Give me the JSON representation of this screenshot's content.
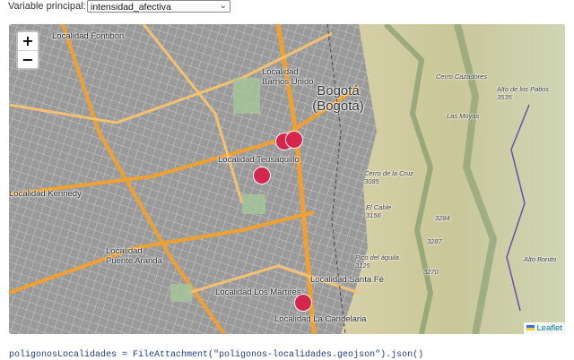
{
  "control": {
    "label": "Variable principal:",
    "selected_option": "intensidad_afectiva"
  },
  "map": {
    "zoom_in": "+",
    "zoom_out": "−",
    "attribution": "Leaflet",
    "labels": {
      "fontibon": "Localidad Fontibón",
      "barrios_unidos": "Localidad Barrios Unido",
      "bogota": "Bogotá (Bogotá)",
      "teusaquillo": "Localidad Teusaquillo",
      "kennedy": "Localidad Kennedy",
      "puente_aranda": "Localidad Puente Aranda",
      "martires": "Localidad Los Mártires",
      "santa_fe": "Localidad Santa Fé",
      "candelaria": "Localidad La Candelaria",
      "cerro_cazadores": "Cerro Cazadores",
      "alto_patios": "Alto de los Patios 3535",
      "las_moyas": "Las Moyas",
      "cerro_cruz": "Cerro de la Cruz 3085",
      "el_cable": "El Cable 3156",
      "alto_bonito": "Alto Bonito",
      "pico_aguila": "Pico del águila 3125",
      "elev_3284": "3284",
      "elev_3287": "3287",
      "elev_3270": "3270"
    },
    "markers_count_visible": 4,
    "colors": {
      "marker": "#d6214b",
      "attribution_link": "#0078A8"
    }
  },
  "code_line": "poligonosLocalidades = FileAttachment(\"poligonos-localidades.geojson\").json()"
}
